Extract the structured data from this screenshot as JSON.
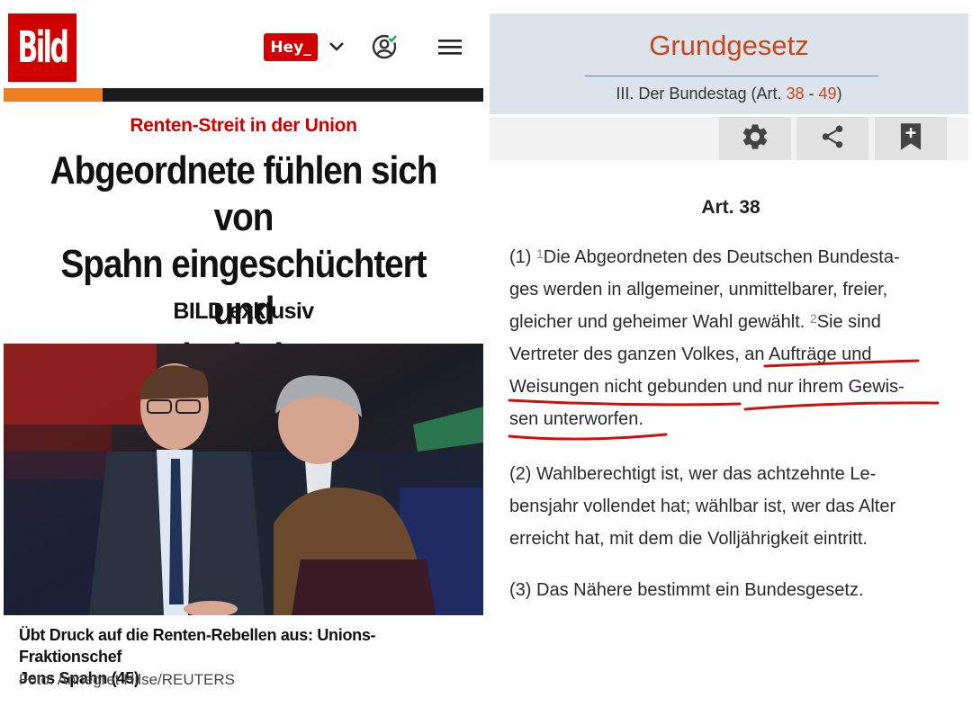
{
  "bild": {
    "logo_text": "Bild",
    "header": {
      "hey_label": "Hey_",
      "icons": [
        "chevron-down-icon",
        "account-icon",
        "menu-icon"
      ]
    },
    "kicker": "Renten-Streit in der Union",
    "headline_lines": [
      "Abgeordnete fühlen sich von",
      "Spahn eingeschüchtert und",
      "bedroht"
    ],
    "exclusive": "BILD exklusiv",
    "caption_lines": [
      "Übt Druck auf die Renten-Rebellen aus: Unions-Fraktionschef",
      "Jens Spahn (45)"
    ],
    "photo_credit": "Foto: Annegret Hilse/REUTERS",
    "colors": {
      "brand_red": "#d00000",
      "accent_orange": "#ee7e22"
    }
  },
  "grundgesetz": {
    "title": "Grundgesetz",
    "subtitle_prefix": "III. Der Bundestag (Art. ",
    "subtitle_from": "38",
    "subtitle_sep": " - ",
    "subtitle_to": "49",
    "subtitle_suffix": ")",
    "toolbar_icons": [
      "settings-gear-icon",
      "share-icon",
      "bookmark-add-icon"
    ],
    "article_heading": "Art. 38",
    "para1": {
      "marker": "(1) ",
      "sup1": "1",
      "l1": "Die Abgeordneten des Deutschen Bundesta-",
      "l2": "ges werden in allgemeiner, unmittelbarer, freier,",
      "l3a": "gleicher und geheimer Wahl gewählt. ",
      "sup2": "2",
      "l3b": "Sie sind",
      "l4": "Vertreter des ganzen Volkes, an Aufträge und",
      "l5": "Weisungen nicht gebunden und nur ihrem Gewis-",
      "l6": "sen unterworfen."
    },
    "para2": {
      "l1": "(2) Wahlberechtigt ist, wer das achtzehnte Le-",
      "l2": "bensjahr vollendet hat; wählbar ist, wer das Alter",
      "l3": "erreicht hat, mit dem die Volljährigkeit eintritt."
    },
    "para3": {
      "l1": "(3) Das Nähere bestimmt ein Bundesgesetz."
    },
    "colors": {
      "title": "#c8461a",
      "header_bg": "#dde3ea",
      "underline": "#cc1111"
    }
  }
}
